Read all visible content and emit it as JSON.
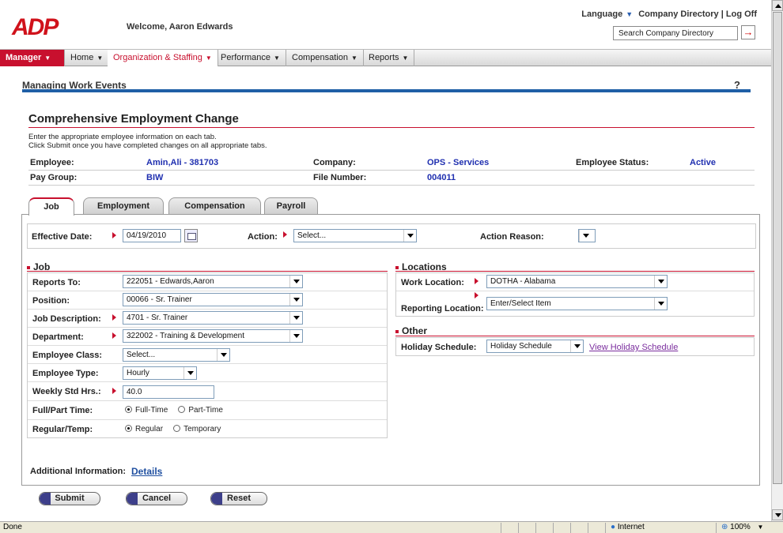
{
  "header": {
    "welcome": "Welcome, Aaron Edwards",
    "language": "Language",
    "company_directory": "Company Directory",
    "separator": "|",
    "logout": "Log Off",
    "search_placeholder": "Search Company Directory"
  },
  "nav": {
    "items": [
      "Manager",
      "Home",
      "Organization & Staffing",
      "Performance",
      "Compensation",
      "Reports"
    ]
  },
  "page": {
    "section": "Managing Work Events",
    "help": "?",
    "title": "Comprehensive Employment Change",
    "instructions_1": "Enter the appropriate employee information on each tab.",
    "instructions_2": "Click Submit once you have completed changes on all appropriate tabs."
  },
  "employee_info": {
    "employee_label": "Employee:",
    "employee_value": "Amin,Ali - 381703",
    "company_label": "Company:",
    "company_value": "OPS - Services",
    "status_label": "Employee Status:",
    "status_value": "Active",
    "paygroup_label": "Pay Group:",
    "paygroup_value": "BIW",
    "filenum_label": "File Number:",
    "filenum_value": "004011"
  },
  "tabs": [
    "Job",
    "Employment",
    "Compensation",
    "Payroll"
  ],
  "effective": {
    "date_label": "Effective Date:",
    "date_value": "04/19/2010",
    "action_label": "Action:",
    "action_value": "Select...",
    "reason_label": "Action Reason:"
  },
  "job": {
    "title": "Job",
    "reports_to_label": "Reports To:",
    "reports_to_value": "222051 - Edwards,Aaron",
    "position_label": "Position:",
    "position_value": "00066 - Sr. Trainer",
    "job_desc_label": "Job Description:",
    "job_desc_value": "4701 - Sr. Trainer",
    "department_label": "Department:",
    "department_value": "322002 - Training & Development",
    "emp_class_label": "Employee Class:",
    "emp_class_value": "Select...",
    "emp_type_label": "Employee Type:",
    "emp_type_value": "Hourly",
    "weekly_label": "Weekly Std Hrs.:",
    "weekly_value": "40.0",
    "fullpart_label": "Full/Part Time:",
    "full_time": "Full-Time",
    "part_time": "Part-Time",
    "regtemp_label": "Regular/Temp:",
    "regular": "Regular",
    "temporary": "Temporary"
  },
  "locations": {
    "title": "Locations",
    "work_label": "Work Location:",
    "work_value": "DOTHA - Alabama",
    "reporting_label": "Reporting Location:",
    "reporting_value": "Enter/Select Item"
  },
  "other": {
    "title": "Other",
    "holiday_label": "Holiday Schedule:",
    "holiday_value": "Holiday Schedule",
    "view_link": "View Holiday Schedule"
  },
  "additional": {
    "label": "Additional Information:",
    "link": "Details"
  },
  "buttons": {
    "submit": "Submit",
    "cancel": "Cancel",
    "reset": "Reset"
  },
  "statusbar": {
    "left": "Done",
    "zone": "Internet",
    "zoom": "100%"
  }
}
